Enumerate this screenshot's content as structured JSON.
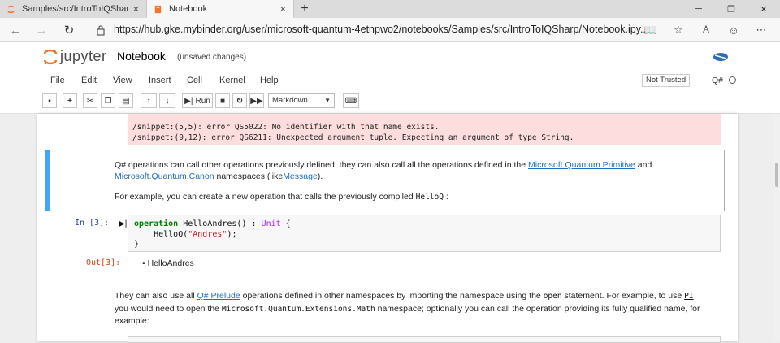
{
  "browser": {
    "tabs": [
      {
        "label": "Samples/src/IntroToIQSharp/"
      },
      {
        "label": "Notebook"
      }
    ],
    "url": "https://hub.gke.mybinder.org/user/microsoft-quantum-4etnpwo2/notebooks/Samples/src/IntroToIQSharp/Notebook.ipy..."
  },
  "jupyter": {
    "brand": "jupyter",
    "notebook_name": "Notebook",
    "save_status": "(unsaved changes)",
    "menu": [
      "File",
      "Edit",
      "View",
      "Insert",
      "Cell",
      "Kernel",
      "Help"
    ],
    "trust": "Not Trusted",
    "kernel": "Q#"
  },
  "toolbar": {
    "run_label": "Run",
    "cell_type": "Markdown"
  },
  "cells": {
    "error_lines": [
      "/snippet:(5,5): error QS5022: No identifier with that name exists.",
      "/snippet:(9,12): error QS6211: Unexpected argument tuple. Expecting an argument of type String."
    ],
    "md1": {
      "p1a": "Q# operations can call other operations previously defined; they can also call all the operations defined in the",
      "link1": "Microsoft.Quantum.Primitive",
      "and": "and",
      "link2": "Microsoft.Quantum.Canon",
      "p1b": "namespaces (like",
      "link3": "Message",
      "p1c": ").",
      "p2": "For example, you can create a new operation that calls the previously compiled",
      "p2code": "HelloQ",
      "p2end": ":"
    },
    "code": {
      "prompt": "In [3]:",
      "lines": [
        {
          "kw": "operation",
          "rest": " HelloAndres() : ",
          "ty": "Unit",
          "end": " {"
        },
        {
          "indent": "    ",
          "call": "HelloQ(",
          "str": "\"Andres\"",
          "end": ");"
        },
        {
          "text": "}"
        }
      ]
    },
    "output": {
      "prompt": "Out[3]:",
      "bullet": "HelloAndres"
    },
    "md2": {
      "a": "They can also use all",
      "link": "Q# Prelude",
      "b": "operations defined in other namespaces by importing the namespace using the",
      "code1": "open",
      "c": "statement. For example, to use",
      "code2": "PI",
      "d": "you would need to open the",
      "code3": "Microsoft.Quantum.Extensions.Math",
      "e": "namespace; optionally you can call the operation providing its fully qualified name, for",
      "f": "example:"
    }
  }
}
